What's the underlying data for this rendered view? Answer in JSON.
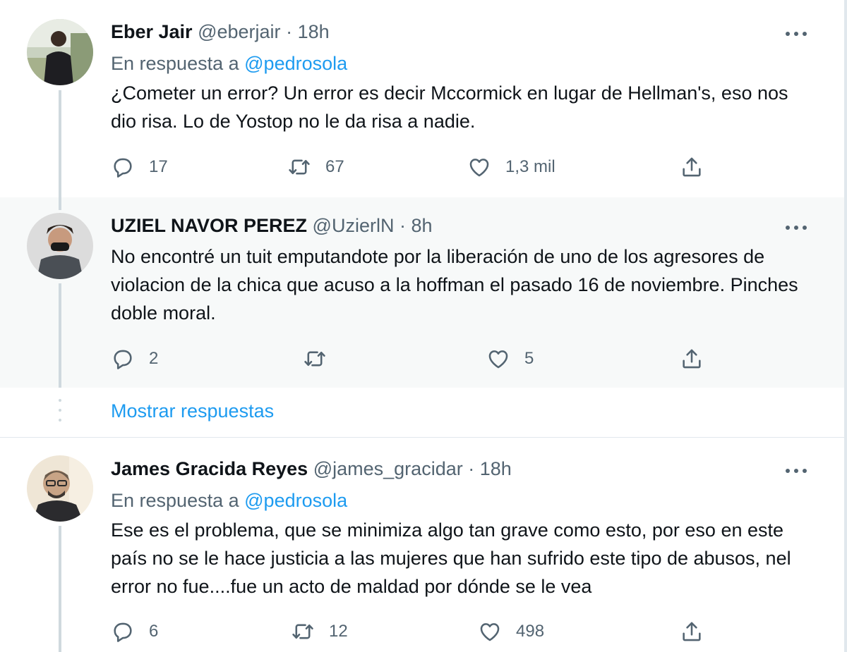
{
  "tweets": [
    {
      "name": "Eber Jair",
      "handle": "@eberjair",
      "separator": "·",
      "time": "18h",
      "reply_prefix": "En respuesta a",
      "reply_to": "@pedrosola",
      "text": "¿Cometer un error? Un error es decir Mccormick en lugar de Hellman's, eso nos dio risa. Lo de Yostop no le da risa a nadie.",
      "replies": "17",
      "retweets": "67",
      "likes": "1,3 mil"
    },
    {
      "name": "UZIEL NAVOR PEREZ",
      "handle": "@UzierlN",
      "separator": "·",
      "time": "8h",
      "text": "No encontré un tuit emputandote por la liberación de uno de los agresores de violacion de la chica que acuso a la hoffman el pasado 16 de noviembre. Pinches doble moral.",
      "replies": "2",
      "retweets": "",
      "likes": "5"
    },
    {
      "name": "James Gracida Reyes",
      "handle": "@james_gracidar",
      "separator": "·",
      "time": "18h",
      "reply_prefix": "En respuesta a",
      "reply_to": "@pedrosola",
      "text": "Ese es el problema, que se minimiza algo tan grave como esto, por eso en este país no se le hace justicia a las mujeres que han sufrido este tipo de abusos, nel error no fue....fue un acto de maldad por dónde se le vea",
      "replies": "6",
      "retweets": "12",
      "likes": "498"
    }
  ],
  "show_replies_label": "Mostrar respuestas",
  "icons": [
    "reply-icon",
    "retweet-icon",
    "like-icon",
    "share-icon",
    "more-icon"
  ],
  "colors": {
    "link": "#1d9bf0",
    "muted": "#536471",
    "text": "#0f1419",
    "thread": "#cfd9de"
  }
}
